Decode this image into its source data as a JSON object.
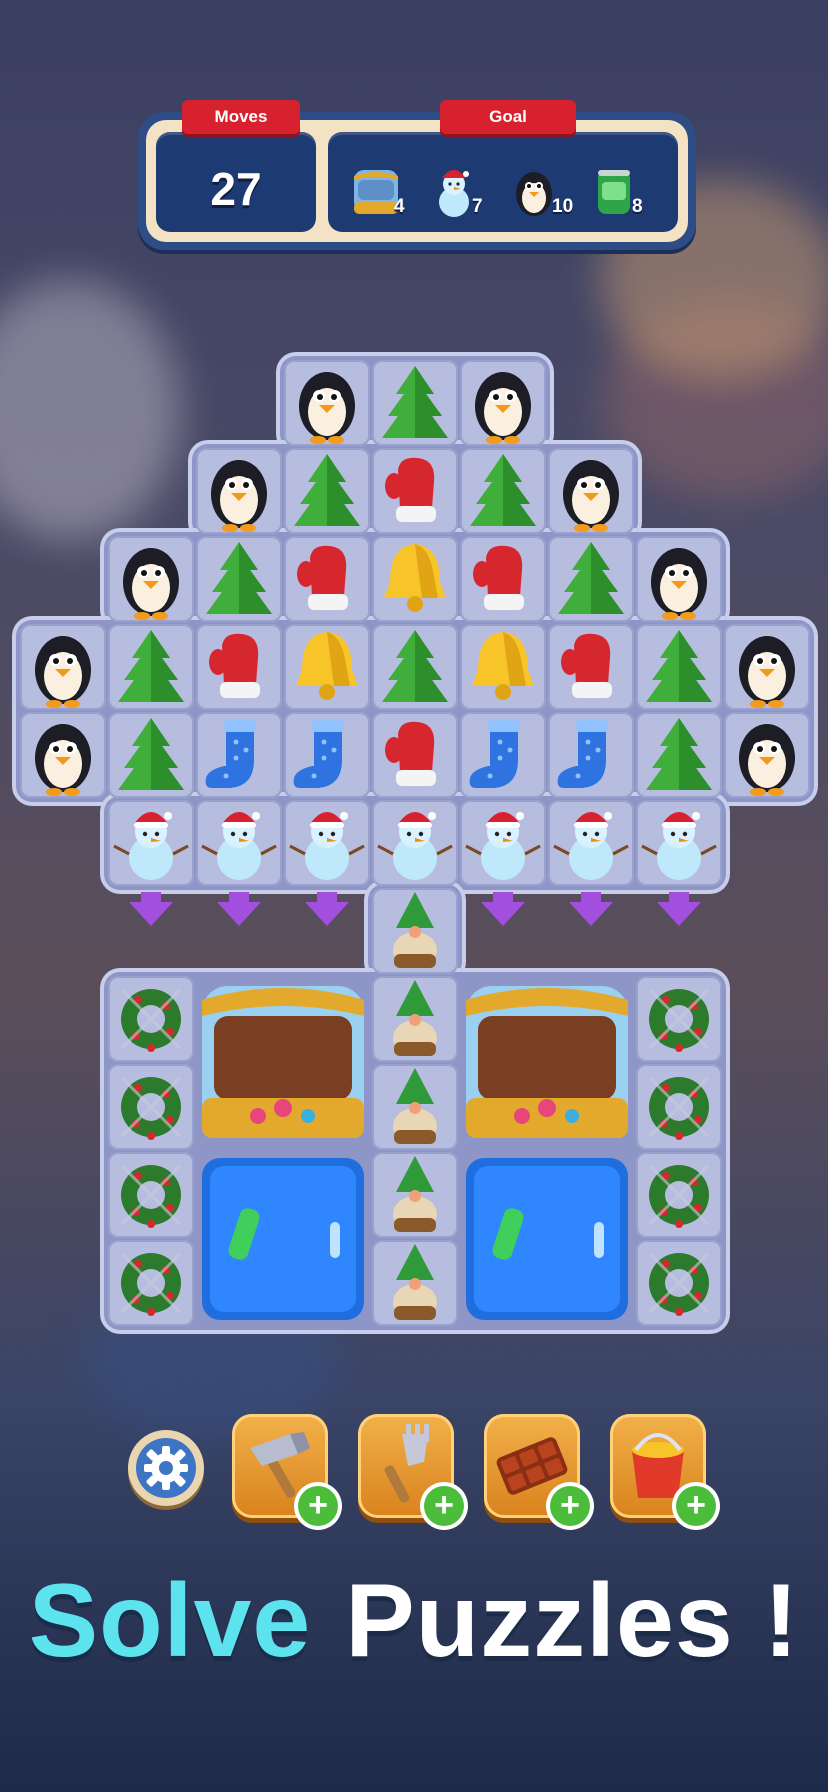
{
  "hud": {
    "moves_label": "Moves",
    "moves_value": "27",
    "goal_label": "Goal",
    "goals": [
      {
        "icon": "jar-icon",
        "count": "4"
      },
      {
        "icon": "snowman-icon",
        "count": "7"
      },
      {
        "icon": "penguin-icon",
        "count": "10"
      },
      {
        "icon": "soda-can-icon",
        "count": "8"
      }
    ]
  },
  "board": {
    "rows": [
      [
        "",
        "",
        "",
        "penguin",
        "tree",
        "penguin",
        "",
        "",
        ""
      ],
      [
        "",
        "",
        "penguin",
        "tree",
        "mitten",
        "tree",
        "penguin",
        "",
        ""
      ],
      [
        "",
        "penguin",
        "tree",
        "mitten",
        "bell",
        "mitten",
        "tree",
        "penguin",
        ""
      ],
      [
        "penguin",
        "tree",
        "mitten",
        "bell",
        "tree",
        "bell",
        "mitten",
        "tree",
        "penguin"
      ],
      [
        "penguin",
        "tree",
        "sock",
        "sock",
        "mitten",
        "sock",
        "sock",
        "tree",
        "penguin"
      ],
      [
        "",
        "snowman",
        "snowman",
        "snowman",
        "snowman",
        "snowman",
        "snowman",
        "snowman",
        ""
      ],
      [
        "",
        "arrow",
        "arrow",
        "arrow",
        "gnome",
        "arrow",
        "arrow",
        "arrow",
        ""
      ],
      [
        "",
        "wreath",
        "jar",
        "jar",
        "gnome",
        "jar",
        "jar",
        "wreath",
        ""
      ],
      [
        "",
        "wreath",
        "jar",
        "jar",
        "gnome",
        "jar",
        "jar",
        "wreath",
        ""
      ],
      [
        "",
        "wreath",
        "fridge",
        "fridge",
        "gnome",
        "fridge",
        "fridge",
        "wreath",
        ""
      ],
      [
        "",
        "wreath",
        "fridge",
        "fridge",
        "gnome",
        "fridge",
        "fridge",
        "wreath",
        ""
      ]
    ]
  },
  "boosters": [
    {
      "name": "hammer-icon"
    },
    {
      "name": "fork-icon"
    },
    {
      "name": "chocolate-bar-icon"
    },
    {
      "name": "bucket-icon"
    }
  ],
  "settings_icon": "gear-icon",
  "headline": {
    "word1": "Solve",
    "word2": "Puzzles !"
  },
  "colors": {
    "accent": "#5de3ee",
    "ribbon": "#d8212f",
    "panel": "#1e3a72",
    "plus": "#4bbd3a"
  }
}
